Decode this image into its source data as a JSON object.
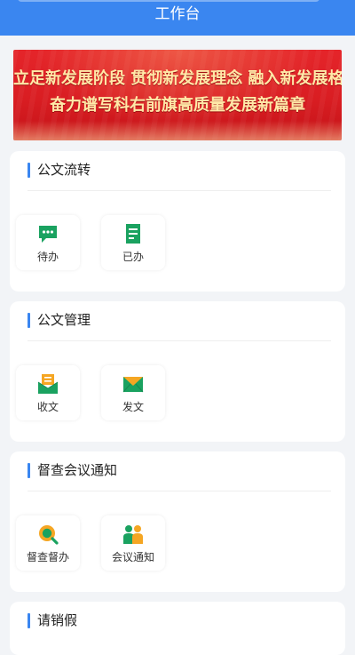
{
  "header": {
    "title": "工作台"
  },
  "banner": {
    "line1": "立足新发展阶段 贯彻新发展理念 融入新发展格局",
    "line2": "奋力谱写科右前旗高质量发展新篇章"
  },
  "sections": [
    {
      "title": "公文流转",
      "items": [
        {
          "label": "待办",
          "icon": "message-dots-icon"
        },
        {
          "label": "已办",
          "icon": "document-lines-icon"
        }
      ]
    },
    {
      "title": "公文管理",
      "items": [
        {
          "label": "收文",
          "icon": "inbox-document-icon"
        },
        {
          "label": "发文",
          "icon": "envelope-icon"
        }
      ]
    },
    {
      "title": "督查会议通知",
      "items": [
        {
          "label": "督查督办",
          "icon": "magnifier-icon"
        },
        {
          "label": "会议通知",
          "icon": "people-icon"
        }
      ]
    },
    {
      "title": "请销假",
      "items": []
    }
  ],
  "colors": {
    "accent": "#3a86f0",
    "icon_green": "#1aa260",
    "icon_orange": "#f5a623",
    "banner_red": "#d91d22",
    "banner_text": "#ffe9a8"
  }
}
